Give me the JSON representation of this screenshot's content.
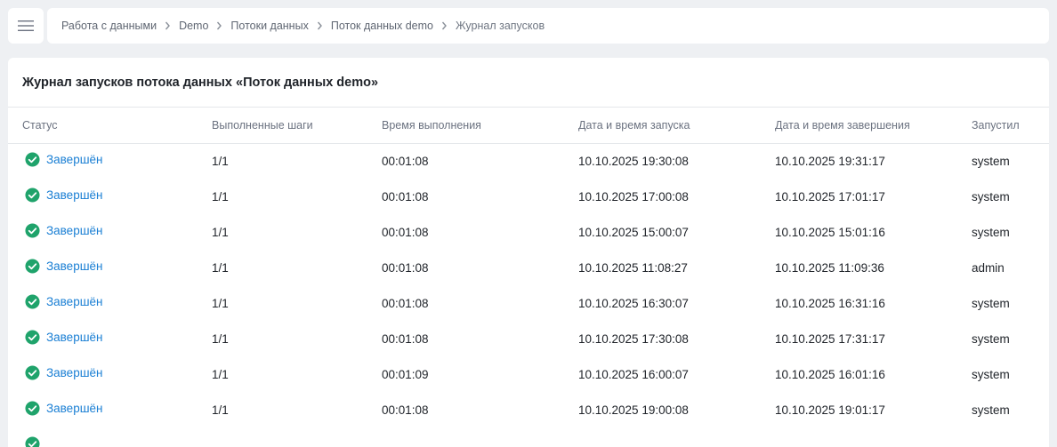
{
  "breadcrumb": [
    {
      "label": "Работа с данными"
    },
    {
      "label": "Demo"
    },
    {
      "label": "Потоки данных"
    },
    {
      "label": "Поток данных demo"
    },
    {
      "label": "Журнал запусков"
    }
  ],
  "panel": {
    "title": "Журнал запусков потока данных «Поток данных demo»"
  },
  "table": {
    "columns": [
      "Статус",
      "Выполненные шаги",
      "Время выполнения",
      "Дата и время запуска",
      "Дата и время завершения",
      "Запустил"
    ],
    "rows": [
      {
        "status": "Завершён",
        "steps": "1/1",
        "duration": "00:01:08",
        "start": "10.10.2025 19:30:08",
        "end": "10.10.2025 19:31:17",
        "user": "system"
      },
      {
        "status": "Завершён",
        "steps": "1/1",
        "duration": "00:01:08",
        "start": "10.10.2025 17:00:08",
        "end": "10.10.2025 17:01:17",
        "user": "system"
      },
      {
        "status": "Завершён",
        "steps": "1/1",
        "duration": "00:01:08",
        "start": "10.10.2025 15:00:07",
        "end": "10.10.2025 15:01:16",
        "user": "system"
      },
      {
        "status": "Завершён",
        "steps": "1/1",
        "duration": "00:01:08",
        "start": "10.10.2025 11:08:27",
        "end": "10.10.2025 11:09:36",
        "user": "admin"
      },
      {
        "status": "Завершён",
        "steps": "1/1",
        "duration": "00:01:08",
        "start": "10.10.2025 16:30:07",
        "end": "10.10.2025 16:31:16",
        "user": "system"
      },
      {
        "status": "Завершён",
        "steps": "1/1",
        "duration": "00:01:08",
        "start": "10.10.2025 17:30:08",
        "end": "10.10.2025 17:31:17",
        "user": "system"
      },
      {
        "status": "Завершён",
        "steps": "1/1",
        "duration": "00:01:09",
        "start": "10.10.2025 16:00:07",
        "end": "10.10.2025 16:01:16",
        "user": "system"
      },
      {
        "status": "Завершён",
        "steps": "1/1",
        "duration": "00:01:08",
        "start": "10.10.2025 19:00:08",
        "end": "10.10.2025 19:01:17",
        "user": "system"
      },
      {
        "status": "",
        "steps": "",
        "duration": "",
        "start": "",
        "end": "",
        "user": ""
      }
    ]
  },
  "icons": {
    "menu": "hamburger-menu-icon",
    "separator": "chevron-right-icon",
    "status": "check-circle-icon"
  },
  "colors": {
    "success": "#1fa36b",
    "link": "#1a7fd4",
    "background": "#eef0f3"
  }
}
